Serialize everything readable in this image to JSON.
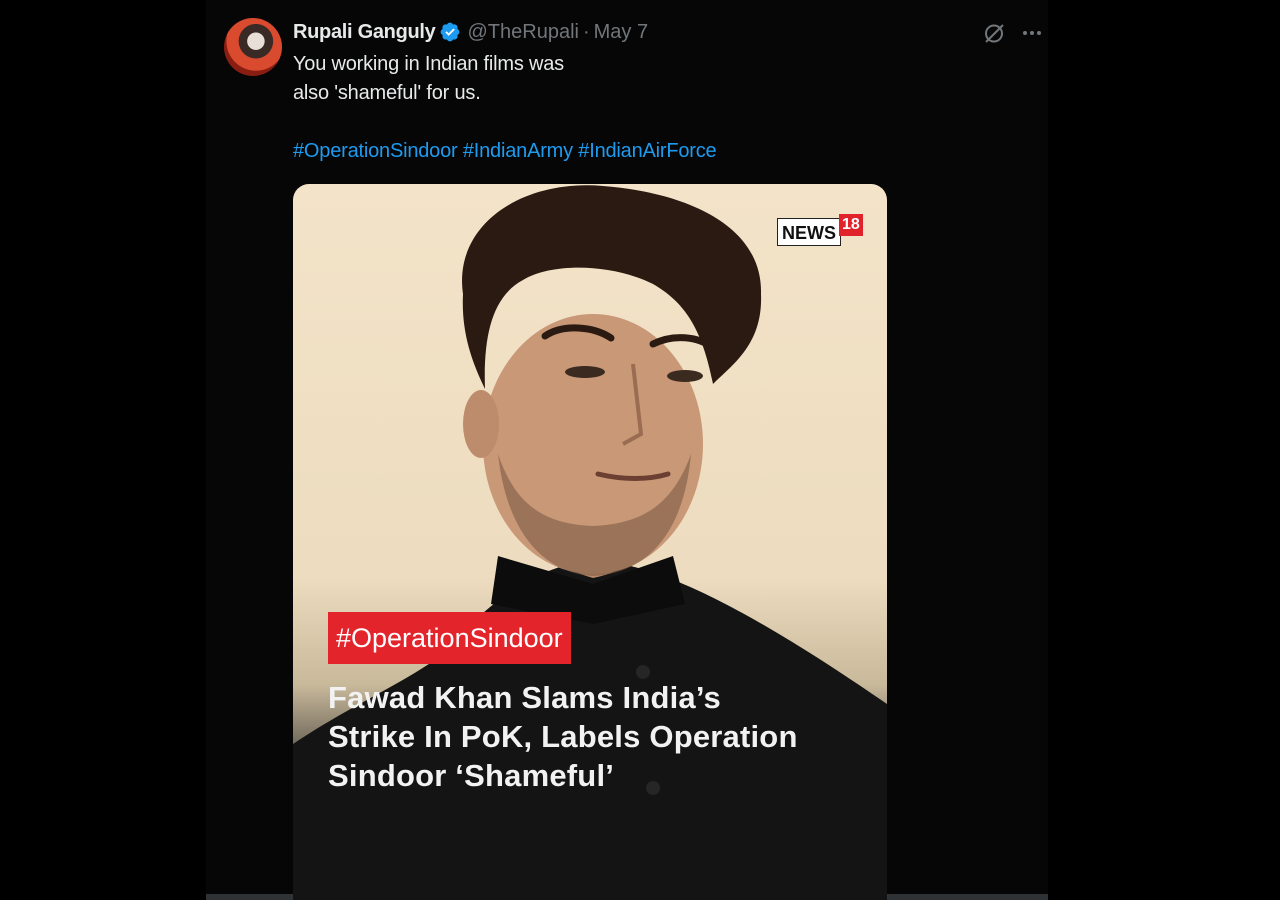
{
  "tweet": {
    "author": {
      "display_name": "Rupali Ganguly",
      "handle": "@TheRupali",
      "separator": "·",
      "date": "May 7",
      "verified": true
    },
    "text_lines": [
      "You working in Indian films was",
      "also 'shameful' for us."
    ],
    "hashtags": [
      "#OperationSindoor",
      "#IndianArmy",
      "#IndianAirForce"
    ],
    "icons": {
      "grok": "grok-icon",
      "more": "more-icon",
      "verified": "verified-badge-icon"
    }
  },
  "media": {
    "logo": {
      "word": "NEWS",
      "number": "18"
    },
    "tag": "#OperationSindoor",
    "headline_lines": [
      "Fawad Khan Slams India’s",
      "Strike In PoK, Labels Operation",
      "Sindoor ‘Shameful’"
    ]
  },
  "colors": {
    "background": "#000000",
    "text": "#e7e9ea",
    "muted": "#71767b",
    "link": "#1d9bf0",
    "badge": "#1d9bf0",
    "tag_red": "#e3242b"
  }
}
